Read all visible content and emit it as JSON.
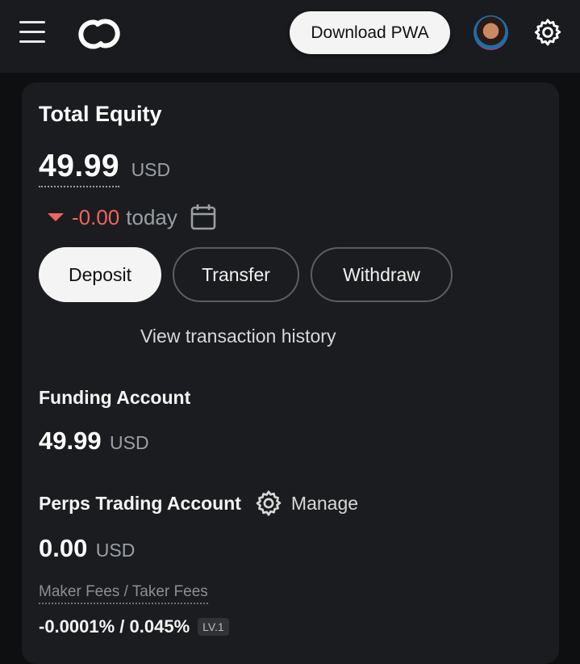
{
  "header": {
    "download_label": "Download PWA",
    "icons": [
      "menu-icon",
      "logo-icon",
      "avatar",
      "settings-icon"
    ]
  },
  "equity": {
    "title": "Total Equity",
    "value": "49.99",
    "unit": "USD",
    "change": "-0.00",
    "change_period": "today",
    "change_color": "#f0645f"
  },
  "actions": {
    "deposit": "Deposit",
    "transfer": "Transfer",
    "withdraw": "Withdraw",
    "history_link": "View transaction history"
  },
  "funding": {
    "title": "Funding Account",
    "value": "49.99",
    "unit": "USD"
  },
  "perps": {
    "title": "Perps Trading Account",
    "manage_label": "Manage",
    "value": "0.00",
    "unit": "USD",
    "fees_label": "Maker Fees / Taker Fees",
    "fees_value": "-0.0001% / 0.045%",
    "level": "LV.1"
  }
}
